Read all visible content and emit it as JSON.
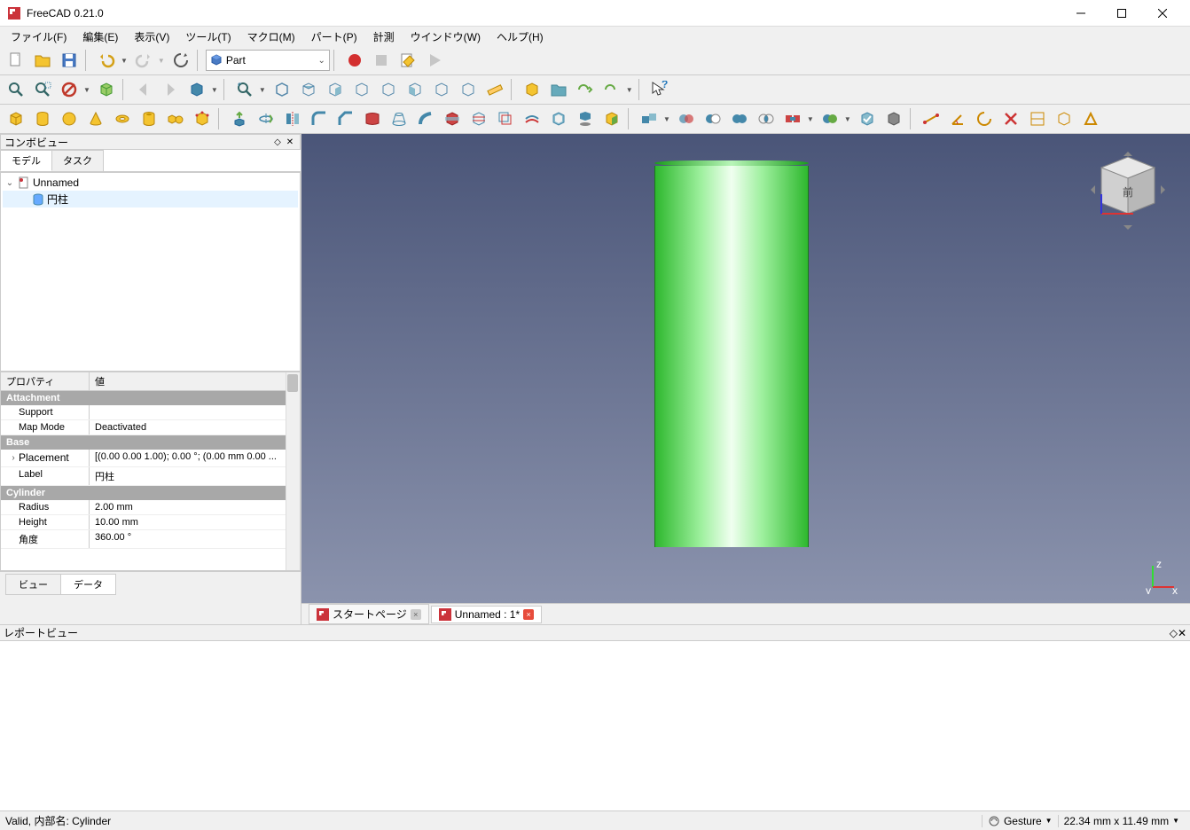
{
  "window": {
    "title": "FreeCAD 0.21.0"
  },
  "menu": {
    "file": "ファイル(F)",
    "edit": "編集(E)",
    "view": "表示(V)",
    "tools": "ツール(T)",
    "macro": "マクロ(M)",
    "part": "パート(P)",
    "measure": "計測",
    "window": "ウインドウ(W)",
    "help": "ヘルプ(H)"
  },
  "workbench": {
    "selected": "Part"
  },
  "comboview": {
    "title": "コンボビュー",
    "tabs": {
      "model": "モデル",
      "task": "タスク"
    },
    "tree": {
      "doc": "Unnamed",
      "item": "円柱"
    }
  },
  "properties": {
    "header_prop": "プロパティ",
    "header_val": "値",
    "groups": {
      "attachment": {
        "label": "Attachment",
        "support": {
          "name": "Support",
          "value": ""
        },
        "mapmode": {
          "name": "Map Mode",
          "value": "Deactivated"
        }
      },
      "base": {
        "label": "Base",
        "placement": {
          "name": "Placement",
          "value": "[(0.00 0.00 1.00); 0.00 °; (0.00 mm  0.00 ..."
        },
        "label_p": {
          "name": "Label",
          "value": "円柱"
        }
      },
      "cylinder": {
        "label": "Cylinder",
        "radius": {
          "name": "Radius",
          "value": "2.00 mm"
        },
        "height": {
          "name": "Height",
          "value": "10.00 mm"
        },
        "angle": {
          "name": "角度",
          "value": "360.00 °"
        }
      }
    },
    "bottom_tabs": {
      "view": "ビュー",
      "data": "データ"
    }
  },
  "viewtabs": {
    "start": "スタートページ",
    "doc": "Unnamed : 1*"
  },
  "navcube": {
    "face": "前"
  },
  "report": {
    "title": "レポートビュー"
  },
  "status": {
    "msg": "Valid, 内部名: Cylinder",
    "nav": "Gesture",
    "dims": "22.34 mm x 11.49 mm"
  }
}
